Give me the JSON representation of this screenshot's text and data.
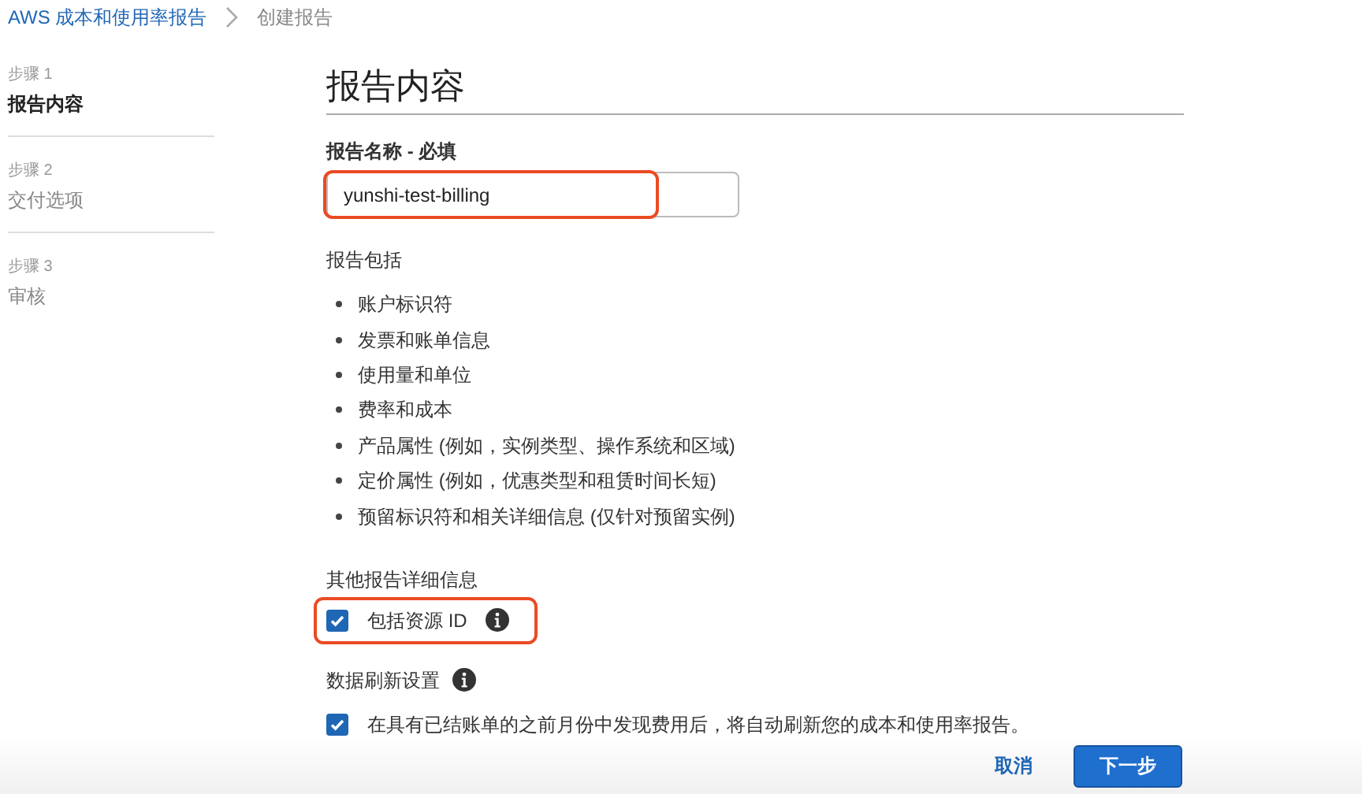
{
  "breadcrumb": [
    {
      "label": "AWS 成本和使用率报告",
      "kind": "link"
    },
    {
      "label": "创建报告",
      "kind": "current"
    }
  ],
  "steps": [
    {
      "step": "步骤 1",
      "label": "报告内容",
      "selected": true
    },
    {
      "step": "步骤 2",
      "label": "交付选项",
      "selected": false
    },
    {
      "step": "步骤 3",
      "label": "审核",
      "selected": false
    }
  ],
  "title": "报告内容",
  "report_name": {
    "label": "报告名称 - 必填",
    "value": "yunshi-test-billing",
    "highlighted": true
  },
  "includes": {
    "heading": "报告包括",
    "items": [
      "账户标识符",
      "发票和账单信息",
      "使用量和单位",
      "费率和成本",
      "产品属性 (例如，实例类型、操作系统和区域)",
      "定价属性 (例如，优惠类型和租赁时间长短)",
      "预留标识符和相关详细信息 (仅针对预留实例)"
    ]
  },
  "additional": {
    "heading": "其他报告详细信息",
    "checkbox": {
      "label": "包括资源 ID",
      "checked": true,
      "highlighted": true
    }
  },
  "refresh": {
    "heading": "数据刷新设置",
    "checkbox": {
      "label": "在具有已结账单的之前月份中发现费用后，将自动刷新您的成本和使用率报告。",
      "checked": true,
      "highlighted": false
    }
  },
  "buttons": [
    {
      "label": "取消",
      "kind": "link"
    },
    {
      "label": "下一步",
      "kind": "primary"
    }
  ]
}
